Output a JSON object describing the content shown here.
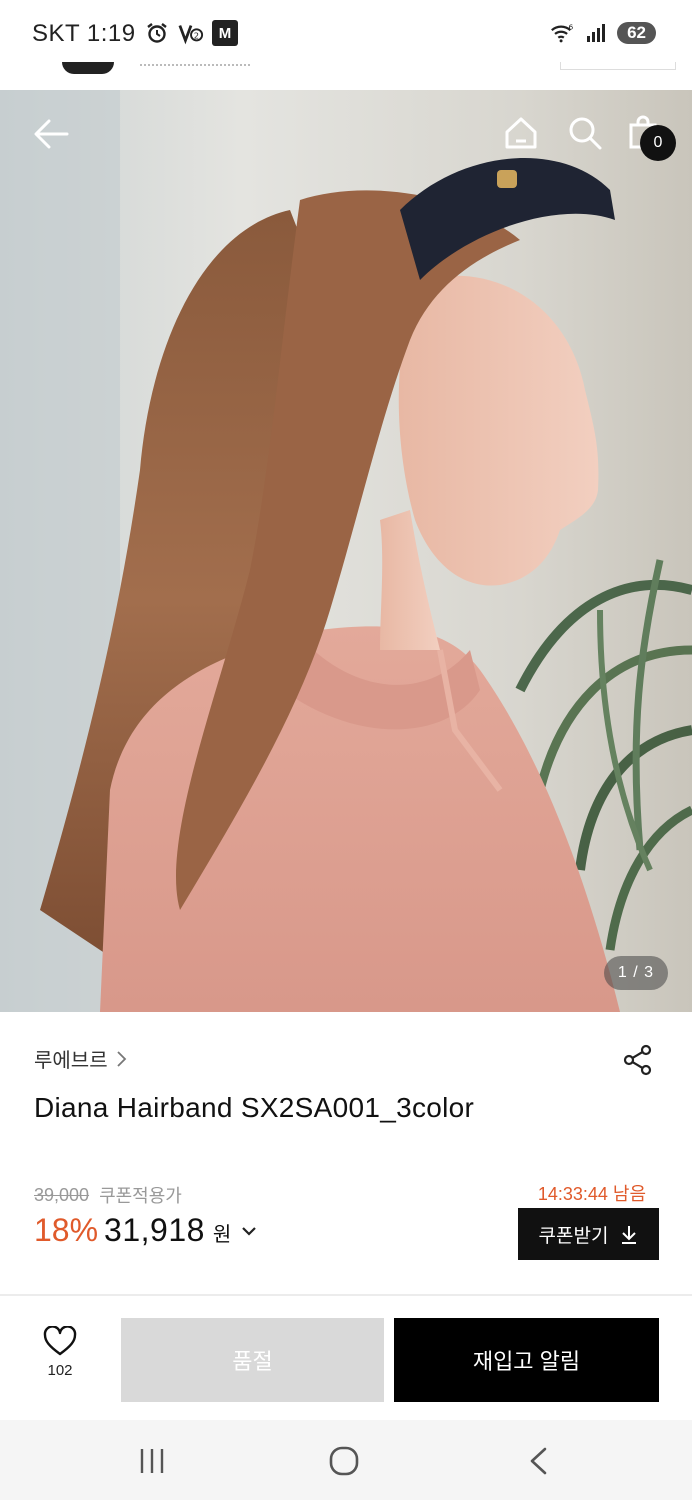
{
  "status_bar": {
    "carrier_time": "SKT 1:19",
    "mstock_label": "M",
    "battery": "62",
    "network_badge": "6"
  },
  "header": {
    "back_icon": "arrow-left-icon",
    "home_icon": "home-icon",
    "search_icon": "search-icon",
    "cart_icon": "shopping-bag-icon",
    "cart_count": "0"
  },
  "gallery": {
    "pager": "1 / 3"
  },
  "product": {
    "brand": "루에브르",
    "title": "Diana Hairband SX2SA001_3color",
    "original_price": "39,000",
    "coupon_label": "쿠폰적용가",
    "discount": "18%",
    "sale_price": "31,918",
    "currency": "원",
    "timer": "14:33:44 남음",
    "coupon_button": "쿠폰받기"
  },
  "bottom_bar": {
    "wish_count": "102",
    "soldout_label": "품절",
    "restock_label": "재입고 알림"
  },
  "colors": {
    "accent": "#e05a2b",
    "primary_button": "#000000",
    "disabled_button": "#d9d9d9"
  }
}
